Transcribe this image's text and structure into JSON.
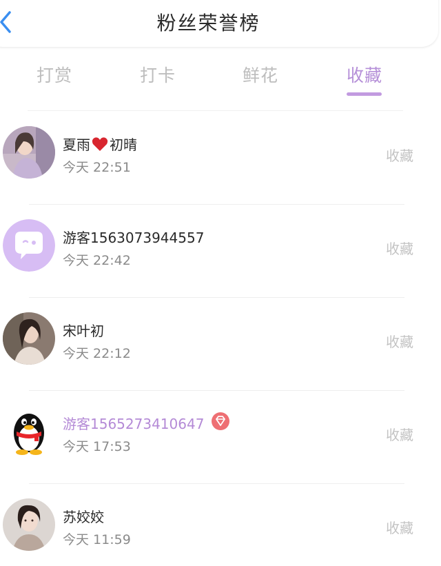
{
  "header": {
    "title": "粉丝荣誉榜",
    "back_icon": "chevron-left-icon"
  },
  "tabs": [
    {
      "label": "打赏",
      "active": false
    },
    {
      "label": "打卡",
      "active": false
    },
    {
      "label": "鲜花",
      "active": false
    },
    {
      "label": "收藏",
      "active": true
    }
  ],
  "colors": {
    "accent": "#b58fd8",
    "back_icon": "#3a8ef0",
    "vip_badge": "#ee6f73"
  },
  "fans": [
    {
      "name_part1": "夏雨",
      "name_icon": "heart-icon",
      "name_part2": "初晴",
      "time": "今天 22:51",
      "action": "收藏",
      "avatar": "photo-avatar"
    },
    {
      "name": "游客1563073944557",
      "time": "今天 22:42",
      "action": "收藏",
      "avatar": "chat-bubble-avatar"
    },
    {
      "name": "宋叶初",
      "time": "今天 22:12",
      "action": "收藏",
      "avatar": "photo-avatar"
    },
    {
      "name": "游客1565273410647",
      "time": "今天 17:53",
      "action": "收藏",
      "avatar": "penguin-avatar",
      "badge": "diamond-icon"
    },
    {
      "name": "苏姣姣",
      "time": "今天 11:59",
      "action": "收藏",
      "avatar": "photo-avatar"
    }
  ]
}
